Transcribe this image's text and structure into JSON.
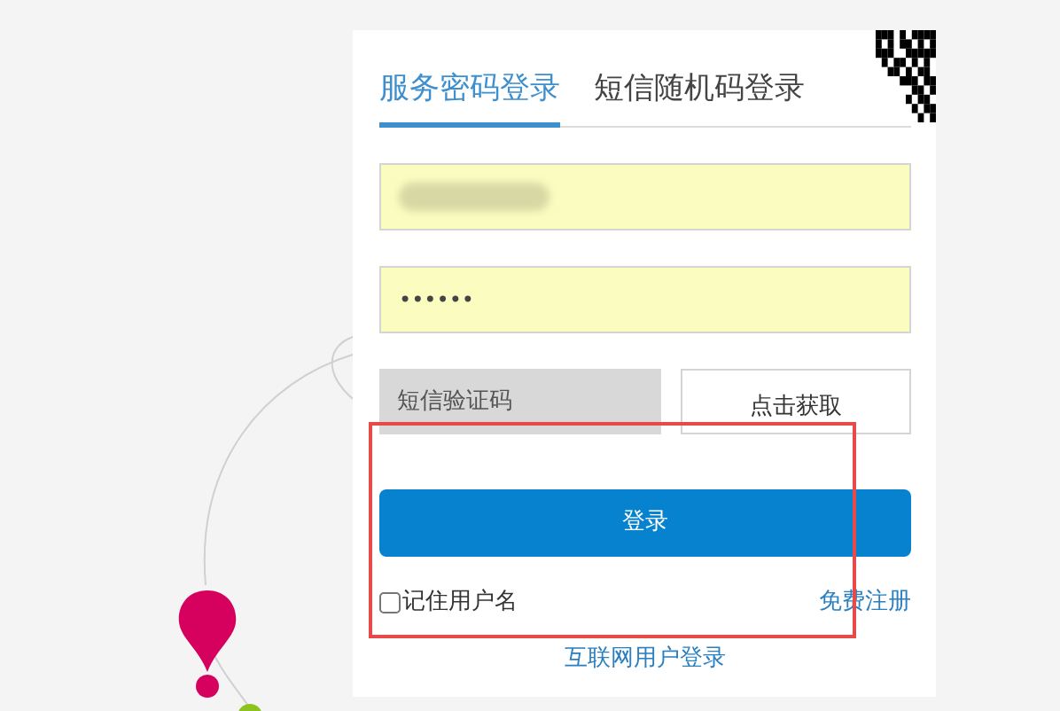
{
  "tabs": [
    {
      "label": "服务密码登录",
      "selected": true
    },
    {
      "label": "短信随机码登录",
      "selected": false
    }
  ],
  "username_field": {
    "obscured": true
  },
  "password_field": {
    "value": "••••••"
  },
  "sms_code_field": {
    "placeholder": "短信验证码"
  },
  "get_code_button": {
    "label": "点击获取"
  },
  "login_button": {
    "label": "登录"
  },
  "remember_username": {
    "label": "记住用户名",
    "checked": false
  },
  "register_link": {
    "label": "免费注册"
  },
  "internet_user_login_link": {
    "label": "互联网用户登录"
  }
}
